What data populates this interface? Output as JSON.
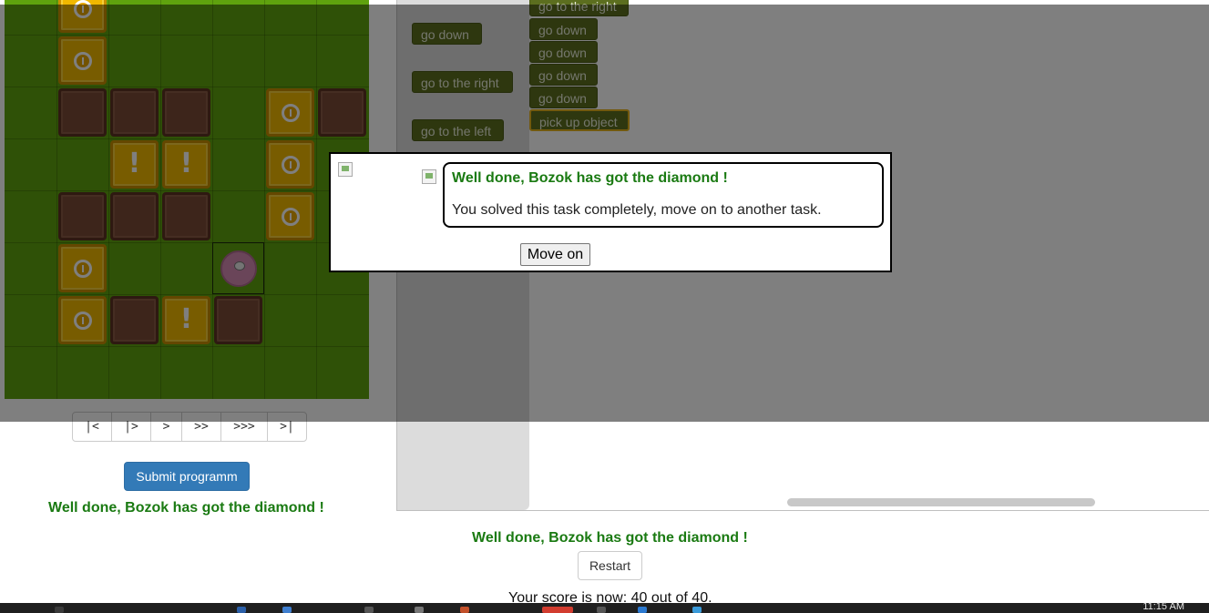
{
  "grid": {
    "cols": 7,
    "rows": 8,
    "cells": [
      {
        "row": 0,
        "col": 1,
        "type": "coin"
      },
      {
        "row": 1,
        "col": 1,
        "type": "coin"
      },
      {
        "row": 2,
        "col": 1,
        "type": "wall"
      },
      {
        "row": 2,
        "col": 2,
        "type": "wall"
      },
      {
        "row": 2,
        "col": 3,
        "type": "wall"
      },
      {
        "row": 2,
        "col": 5,
        "type": "coin"
      },
      {
        "row": 2,
        "col": 6,
        "type": "wall"
      },
      {
        "row": 3,
        "col": 2,
        "type": "question"
      },
      {
        "row": 3,
        "col": 3,
        "type": "question"
      },
      {
        "row": 3,
        "col": 5,
        "type": "coin"
      },
      {
        "row": 4,
        "col": 1,
        "type": "wall"
      },
      {
        "row": 4,
        "col": 2,
        "type": "wall"
      },
      {
        "row": 4,
        "col": 3,
        "type": "wall"
      },
      {
        "row": 4,
        "col": 5,
        "type": "coin"
      },
      {
        "row": 5,
        "col": 1,
        "type": "coin"
      },
      {
        "row": 5,
        "col": 4,
        "type": "robot"
      },
      {
        "row": 6,
        "col": 1,
        "type": "coin"
      },
      {
        "row": 6,
        "col": 2,
        "type": "wall"
      },
      {
        "row": 6,
        "col": 3,
        "type": "question"
      },
      {
        "row": 6,
        "col": 4,
        "type": "wall"
      }
    ]
  },
  "playback": {
    "buttons": [
      {
        "label": "|<",
        "name": "first-step-button"
      },
      {
        "label": "|>",
        "name": "step-button"
      },
      {
        "label": ">",
        "name": "play-button"
      },
      {
        "label": ">>",
        "name": "fast-button"
      },
      {
        "label": ">>>",
        "name": "faster-button"
      },
      {
        "label": ">|",
        "name": "last-step-button"
      }
    ]
  },
  "left": {
    "submit_label": "Submit programm",
    "status": "Well done, Bozok has got the diamond !"
  },
  "toolbox": {
    "blocks": [
      "go down",
      "go to the right",
      "go to the left"
    ]
  },
  "program": {
    "blocks": [
      "go to the right",
      "go down",
      "go down",
      "go down",
      "go down",
      "pick up object"
    ]
  },
  "dialog": {
    "title": "Well done, Bozok has got the diamond !",
    "message": "You solved this task completely, move on to another task.",
    "move_on_label": "Move on"
  },
  "bottom": {
    "status": "Well done, Bozok has got the diamond !",
    "restart_label": "Restart",
    "score": "Your score is now: 40 out of 40."
  },
  "taskbar": {
    "clock": "11:15 AM"
  },
  "colors": {
    "grass": "#5fa20e",
    "success_text": "#1a7a12",
    "primary_button": "#337ab7",
    "block": "#5c6e1f"
  }
}
